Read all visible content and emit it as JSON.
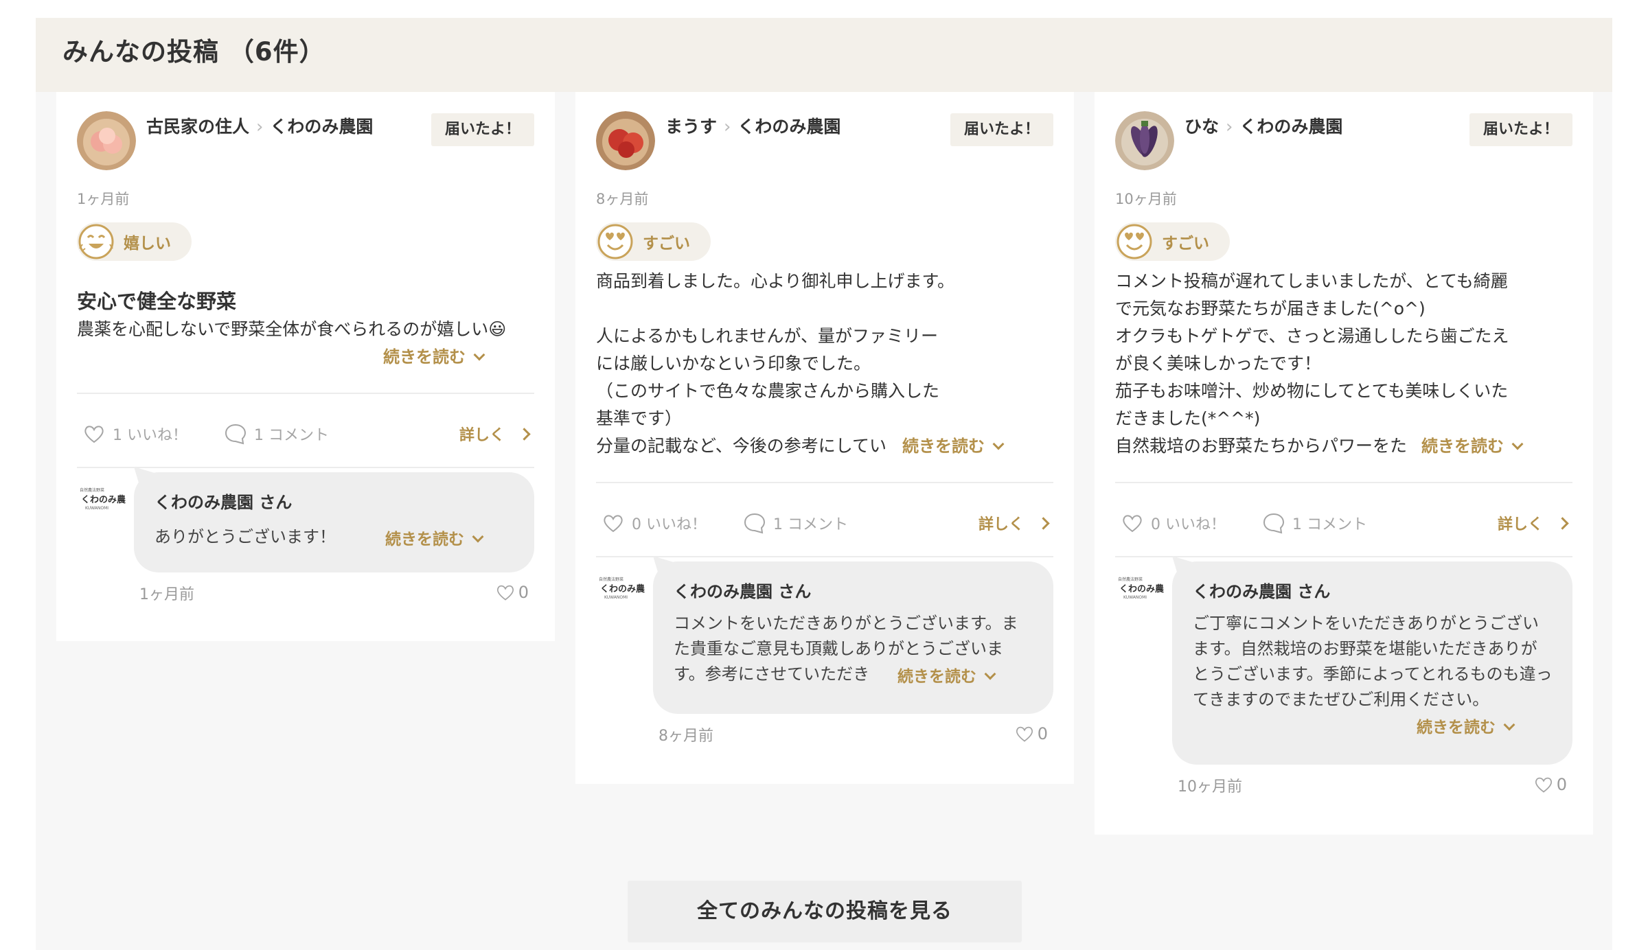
{
  "section": {
    "title": "みんなの投稿 （6件）"
  },
  "posts": [
    {
      "user": "古民家の住人",
      "farm": "くわのみ農園",
      "badge": "届いたよ！",
      "time": "1ヶ月前",
      "reaction": "嬉しい",
      "reaction_icon": "happy-face-icon",
      "title": "安心で健全な野菜",
      "body": "農薬を心配しないで野菜全体が食べられるのが嬉しい😃",
      "read_more": "続きを読む",
      "likes": "1 いいね！",
      "comments": "1 コメント",
      "detail": "詳しく",
      "reply": {
        "name": "くわのみ農園 さん",
        "text": "ありがとうございます！",
        "read_more": "続きを読む",
        "time": "1ヶ月前",
        "likes": "0"
      }
    },
    {
      "user": "まうす",
      "farm": "くわのみ農園",
      "badge": "届いたよ！",
      "time": "8ヶ月前",
      "reaction": "すごい",
      "reaction_icon": "heart-eyes-face-icon",
      "title": "",
      "body": "商品到着しました。心より御礼申し上げます。\n\n人によるかもしれませんが、量がファミリー\nには厳しいかなという印象でした。\n（このサイトで色々な農家さんから購入した\n基準です）\n分量の記載など、今後の参考にしてい",
      "read_more": "続きを読む",
      "likes": "0 いいね！",
      "comments": "1 コメント",
      "detail": "詳しく",
      "reply": {
        "name": "くわのみ農園 さん",
        "text": "コメントをいただきありがとうございます。また貴重なご意見も頂戴しありがとうございます。参考にさせていただき",
        "read_more": "続きを読む",
        "time": "8ヶ月前",
        "likes": "0"
      }
    },
    {
      "user": "ひな",
      "farm": "くわのみ農園",
      "badge": "届いたよ！",
      "time": "10ヶ月前",
      "reaction": "すごい",
      "reaction_icon": "heart-eyes-face-icon",
      "title": "",
      "body": "コメント投稿が遅れてしまいましたが、とても綺麗\nで元気なお野菜たちが届きました(^o^)\nオクラもトゲトゲで、さっと湯通ししたら歯ごたえ\nが良く美味しかったです！\n茄子もお味噌汁、炒め物にしてとても美味しくいた\nだきました(*^^*)\n自然栽培のお野菜たちからパワーをた",
      "read_more": "続きを読む",
      "likes": "0 いいね！",
      "comments": "1 コメント",
      "detail": "詳しく",
      "reply": {
        "name": "くわのみ農園 さん",
        "text": "ご丁寧にコメントをいただきありがとうございます。自然栽培のお野菜を堪能いただきありがとうございます。季節によってとれるものも違ってきますのでまたぜひご利用ください。",
        "read_more": "続きを読む",
        "time": "10ヶ月前",
        "likes": "0"
      }
    }
  ],
  "footer": {
    "see_all": "全てのみんなの投稿を見る"
  },
  "colors": {
    "accent": "#b3904a",
    "header_bg": "#f3f0ea",
    "page_bg": "#f7f7f7"
  }
}
